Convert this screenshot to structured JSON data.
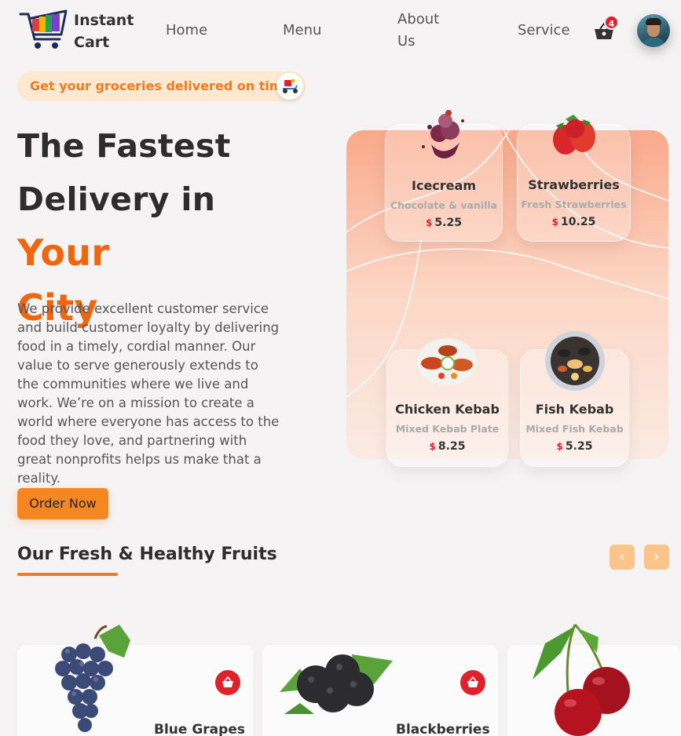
{
  "header": {
    "brand_line1": "Instant",
    "brand_line2": "Cart",
    "nav": [
      "Home",
      "Menu",
      "About",
      "Us",
      "Service"
    ],
    "cart_count": "4"
  },
  "hero": {
    "tagline": "Get your groceries delivered on time",
    "title_line1": "The Fastest",
    "title_line2": "Delivery in",
    "title_accent1": "Your",
    "title_accent2": "City",
    "description": "We provide excellent customer service and build customer loyalty by delivering food in a timely, cordial manner. Our value to serve generously extends to the communities where we live and work. We’re on a mission to create a world where everyone has access to the food they love, and partnering with great nonprofits helps us make that a reality.",
    "cta": "Order Now"
  },
  "menu_cards": [
    {
      "name": "Icecream",
      "sub": "Chocolate & vanilla",
      "currency": "$",
      "price": "5.25"
    },
    {
      "name": "Strawberries",
      "sub": "Fresh Strawberries",
      "currency": "$",
      "price": "10.25"
    },
    {
      "name": "Chicken Kebab",
      "sub": "Mixed Kebab Plate",
      "currency": "$",
      "price": "8.25"
    },
    {
      "name": "Fish Kebab",
      "sub": "Mixed Fish Kebab",
      "currency": "$",
      "price": "5.25"
    }
  ],
  "fruits_section": {
    "title": "Our Fresh & Healthy Fruits",
    "prev": "‹",
    "next": "›",
    "items": [
      {
        "name": "Blue Grapes"
      },
      {
        "name": "Blackberries"
      },
      {
        "name": ""
      }
    ]
  },
  "colors": {
    "accent": "#f0660e",
    "button": "#f58622",
    "badge": "#e0202a"
  }
}
